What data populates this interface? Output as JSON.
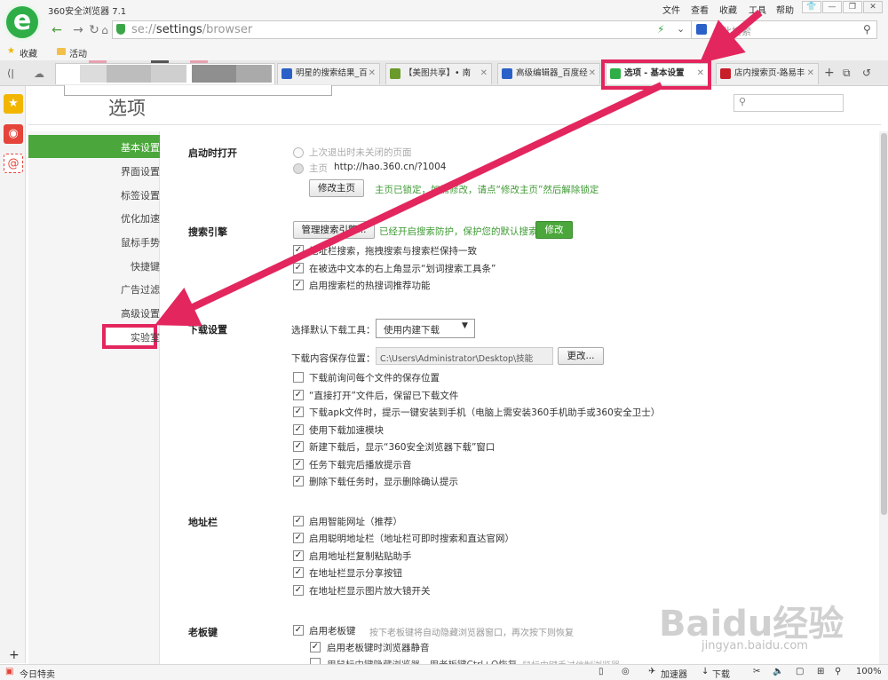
{
  "window": {
    "title": "360安全浏览器 7.1",
    "menus": [
      "文件",
      "查看",
      "收藏",
      "工具",
      "帮助"
    ]
  },
  "address_bar": {
    "prefix": "se://",
    "path": "settings",
    "suffix": "/browser",
    "search_placeholder": "点此搜索"
  },
  "favorites": [
    {
      "label": "收藏",
      "icon": "star-icon"
    },
    {
      "label": "活动",
      "icon": "folder-icon"
    }
  ],
  "tabs": [
    {
      "label": "明星的搜索结果_百",
      "icon": "baidu-paw-icon",
      "active": false
    },
    {
      "label": "【美图共享】• 南",
      "icon": "picture-icon",
      "active": false
    },
    {
      "label": "高级编辑器_百度经",
      "icon": "baidu-paw-icon",
      "active": false
    },
    {
      "label": "选项 - 基本设置",
      "icon": "wrench-icon",
      "active": true
    },
    {
      "label": "店内搜索页-路易丰",
      "icon": "tmall-icon",
      "active": false
    }
  ],
  "settings": {
    "page_title": "选项",
    "nav": [
      {
        "label": "基本设置",
        "active": true
      },
      {
        "label": "界面设置"
      },
      {
        "label": "标签设置"
      },
      {
        "label": "优化加速"
      },
      {
        "label": "鼠标手势"
      },
      {
        "label": "快捷键"
      },
      {
        "label": "广告过滤"
      },
      {
        "label": "高级设置"
      },
      {
        "label": "实验室",
        "highlighted": true
      }
    ],
    "startup": {
      "title": "启动时打开",
      "opt_last": "上次退出时未关闭的页面",
      "opt_home_label": "主页",
      "opt_home_url": "http://hao.360.cn/?1004",
      "modify_home_btn": "修改主页",
      "locked_note": "主页已锁定，如需修改，请点“修改主页”然后解除锁定"
    },
    "search": {
      "title": "搜索引擎",
      "manage_btn": "管理搜索引擎...",
      "protect_note": "已经开启搜索防护，保护您的默认搜索",
      "modify_btn": "修改",
      "options": [
        "地址栏搜索，拖拽搜索与搜索栏保持一致",
        "在被选中文本的右上角显示“划词搜索工具条”",
        "启用搜索栏的热搜词推荐功能"
      ]
    },
    "download": {
      "title": "下载设置",
      "tool_label": "选择默认下载工具：",
      "tool_value": "使用内建下载",
      "path_label": "下载内容保存位置：",
      "path_value": "C:\\Users\\Administrator\\Desktop\\技能",
      "change_btn": "更改...",
      "options": [
        {
          "label": "下载前询问每个文件的保存位置",
          "checked": false
        },
        {
          "label": "“直接打开”文件后，保留已下载文件",
          "checked": true
        },
        {
          "label": "下载apk文件时，提示一键安装到手机（电脑上需安装360手机助手或360安全卫士）",
          "checked": true
        },
        {
          "label": "使用下载加速模块",
          "checked": true
        },
        {
          "label": "新建下载后，显示“360安全浏览器下载”窗口",
          "checked": true
        },
        {
          "label": "任务下载完后播放提示音",
          "checked": true
        },
        {
          "label": "删除下载任务时，显示删除确认提示",
          "checked": true
        }
      ]
    },
    "addressbar": {
      "title": "地址栏",
      "options": [
        "启用智能网址（推荐）",
        "启用聪明地址栏（地址栏可即时搜索和直达官网）",
        "启用地址栏复制粘贴助手",
        "在地址栏显示分享按钮",
        "在地址栏显示图片放大镜开关"
      ]
    },
    "bosskey": {
      "title": "老板键",
      "enable": "启用老板键",
      "enable_note": "按下老板键将自动隐藏浏览器窗口，再次按下则恢复",
      "mute": "启用老板键时浏览器静音",
      "extra": "用鼠标中键隐藏浏览器，用老板键Ctrl+Q恢复",
      "extra_note": "鼠标中键手过信制浏览器"
    }
  },
  "status_bar": {
    "left": "今日特卖",
    "accelerator": "加速器",
    "download": "下载",
    "zoom": "100%"
  },
  "watermark": {
    "main": "Baidu经验",
    "sub": "jingyan.baidu.com"
  },
  "colors": {
    "accent_green": "#4ba73b",
    "highlight_pink": "#e3265e"
  }
}
